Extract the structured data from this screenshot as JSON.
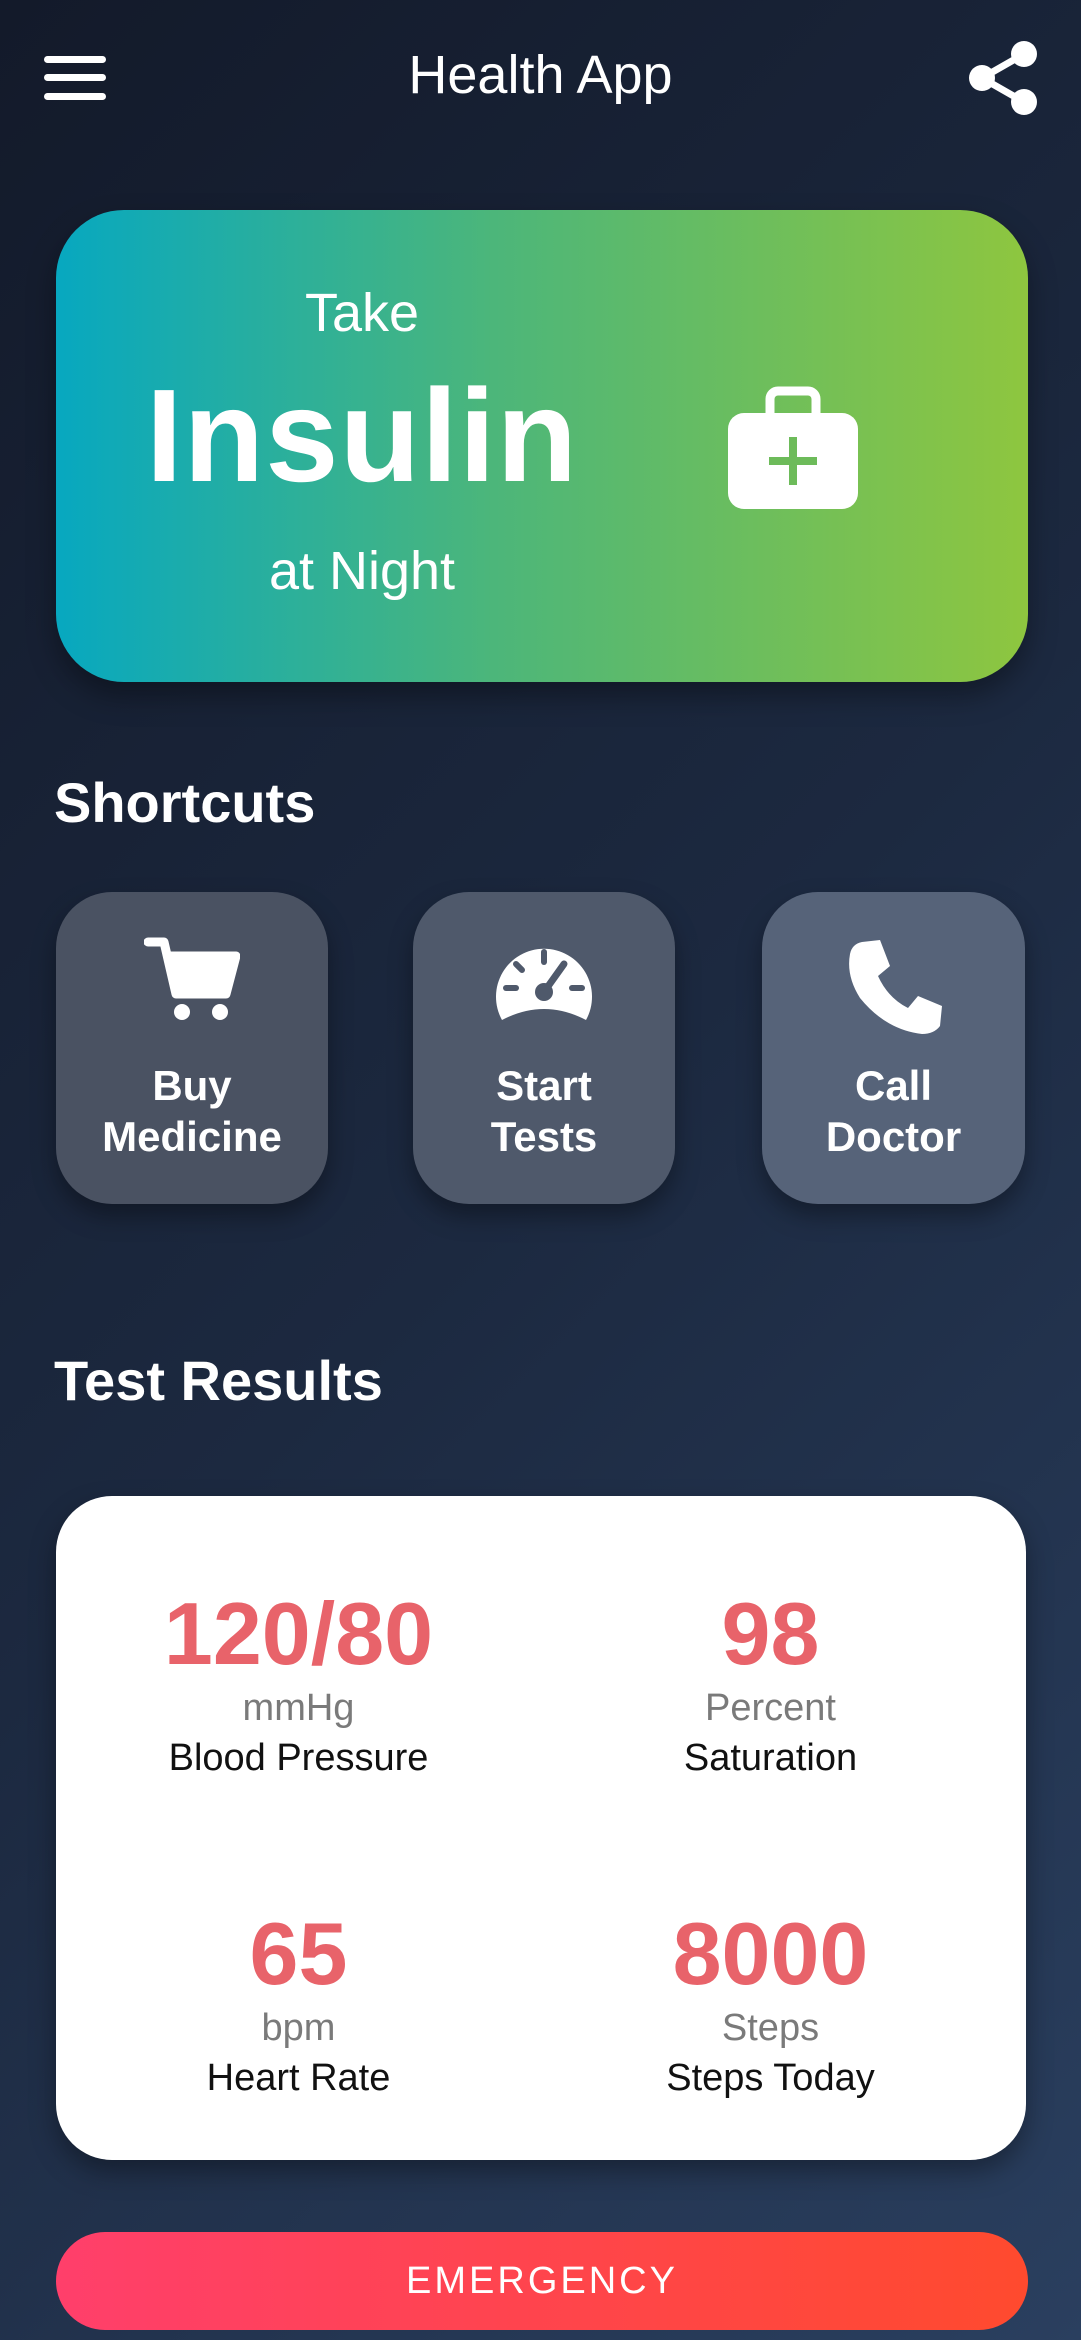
{
  "header": {
    "title": "Health App",
    "menu_icon": "hamburger-menu-icon",
    "share_icon": "share-icon"
  },
  "banner": {
    "line1": "Take",
    "main": "Insulin",
    "line3": "at Night",
    "icon": "first-aid-kit-icon",
    "gradient": [
      "#07a8c0",
      "#8ec63f"
    ]
  },
  "shortcuts": {
    "title": "Shortcuts",
    "items": [
      {
        "line1": "Buy",
        "line2": "Medicine",
        "icon": "shopping-cart-icon"
      },
      {
        "line1": "Start",
        "line2": "Tests",
        "icon": "speedometer-icon"
      },
      {
        "line1": "Call",
        "line2": "Doctor",
        "icon": "phone-icon"
      }
    ]
  },
  "results": {
    "title": "Test Results",
    "value_color": "#e8636a",
    "metrics": [
      {
        "value": "120/80",
        "unit": "mmHg",
        "label": "Blood Pressure"
      },
      {
        "value": "98",
        "unit": "Percent",
        "label": "Saturation"
      },
      {
        "value": "65",
        "unit": "bpm",
        "label": "Heart Rate"
      },
      {
        "value": "8000",
        "unit": "Steps",
        "label": "Steps Today"
      }
    ]
  },
  "emergency": {
    "label": "EMERGENCY",
    "gradient": [
      "#ff3f6b",
      "#ff4a2e"
    ]
  }
}
